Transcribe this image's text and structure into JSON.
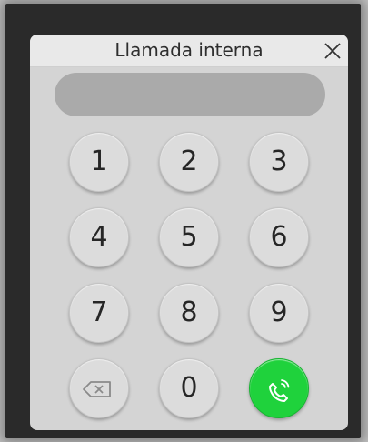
{
  "dialog": {
    "title": "Llamada interna",
    "number_display": ""
  },
  "keypad": {
    "keys": [
      "1",
      "2",
      "3",
      "4",
      "5",
      "6",
      "7",
      "8",
      "9",
      "0"
    ]
  },
  "icons": {
    "close": "close-icon",
    "backspace": "backspace-icon",
    "call": "phone-call-icon"
  },
  "colors": {
    "call_button": "#1fd23c",
    "display_background": "#aaaaaa"
  }
}
